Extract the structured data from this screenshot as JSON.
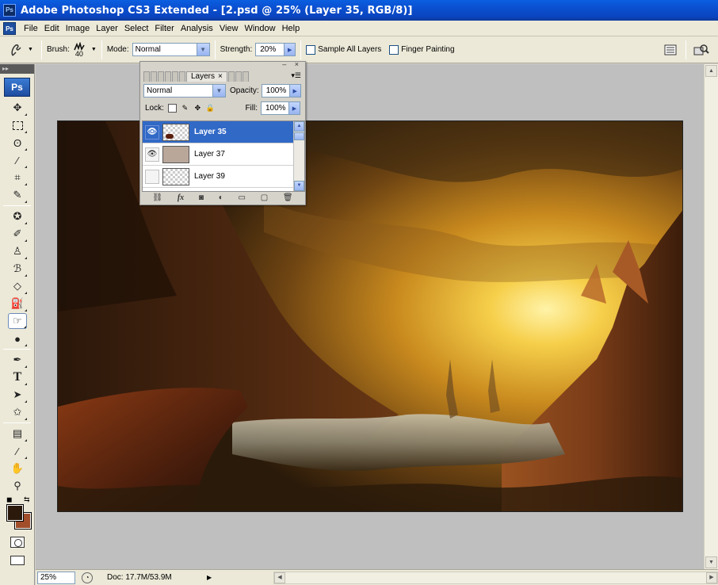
{
  "window": {
    "title": "Adobe Photoshop CS3 Extended - [2.psd @ 25% (Layer 35, RGB/8)]"
  },
  "menu": [
    "File",
    "Edit",
    "Image",
    "Layer",
    "Select",
    "Filter",
    "Analysis",
    "View",
    "Window",
    "Help"
  ],
  "options": {
    "brush_label": "Brush:",
    "brush_size": "40",
    "mode_label": "Mode:",
    "mode_value": "Normal",
    "strength_label": "Strength:",
    "strength_value": "20%",
    "sample_all_layers": "Sample All Layers",
    "finger_painting": "Finger Painting"
  },
  "toolbox": {
    "logo": "Ps",
    "active_tool": "smudge-tool",
    "foreground_color": "#2b1a0c",
    "background_color": "#a24e2b"
  },
  "layers_panel": {
    "tab_label": "Layers",
    "blend_mode": "Normal",
    "opacity_label": "Opacity:",
    "opacity_value": "100%",
    "lock_label": "Lock:",
    "fill_label": "Fill:",
    "fill_value": "100%",
    "layers": [
      {
        "name": "Layer 35",
        "visible": true,
        "selected": true
      },
      {
        "name": "Layer 37",
        "visible": true,
        "selected": false
      },
      {
        "name": "Layer 39",
        "visible": false,
        "selected": false
      }
    ]
  },
  "status": {
    "zoom": "25%",
    "doc": "Doc: 17.7M/53.9M"
  }
}
